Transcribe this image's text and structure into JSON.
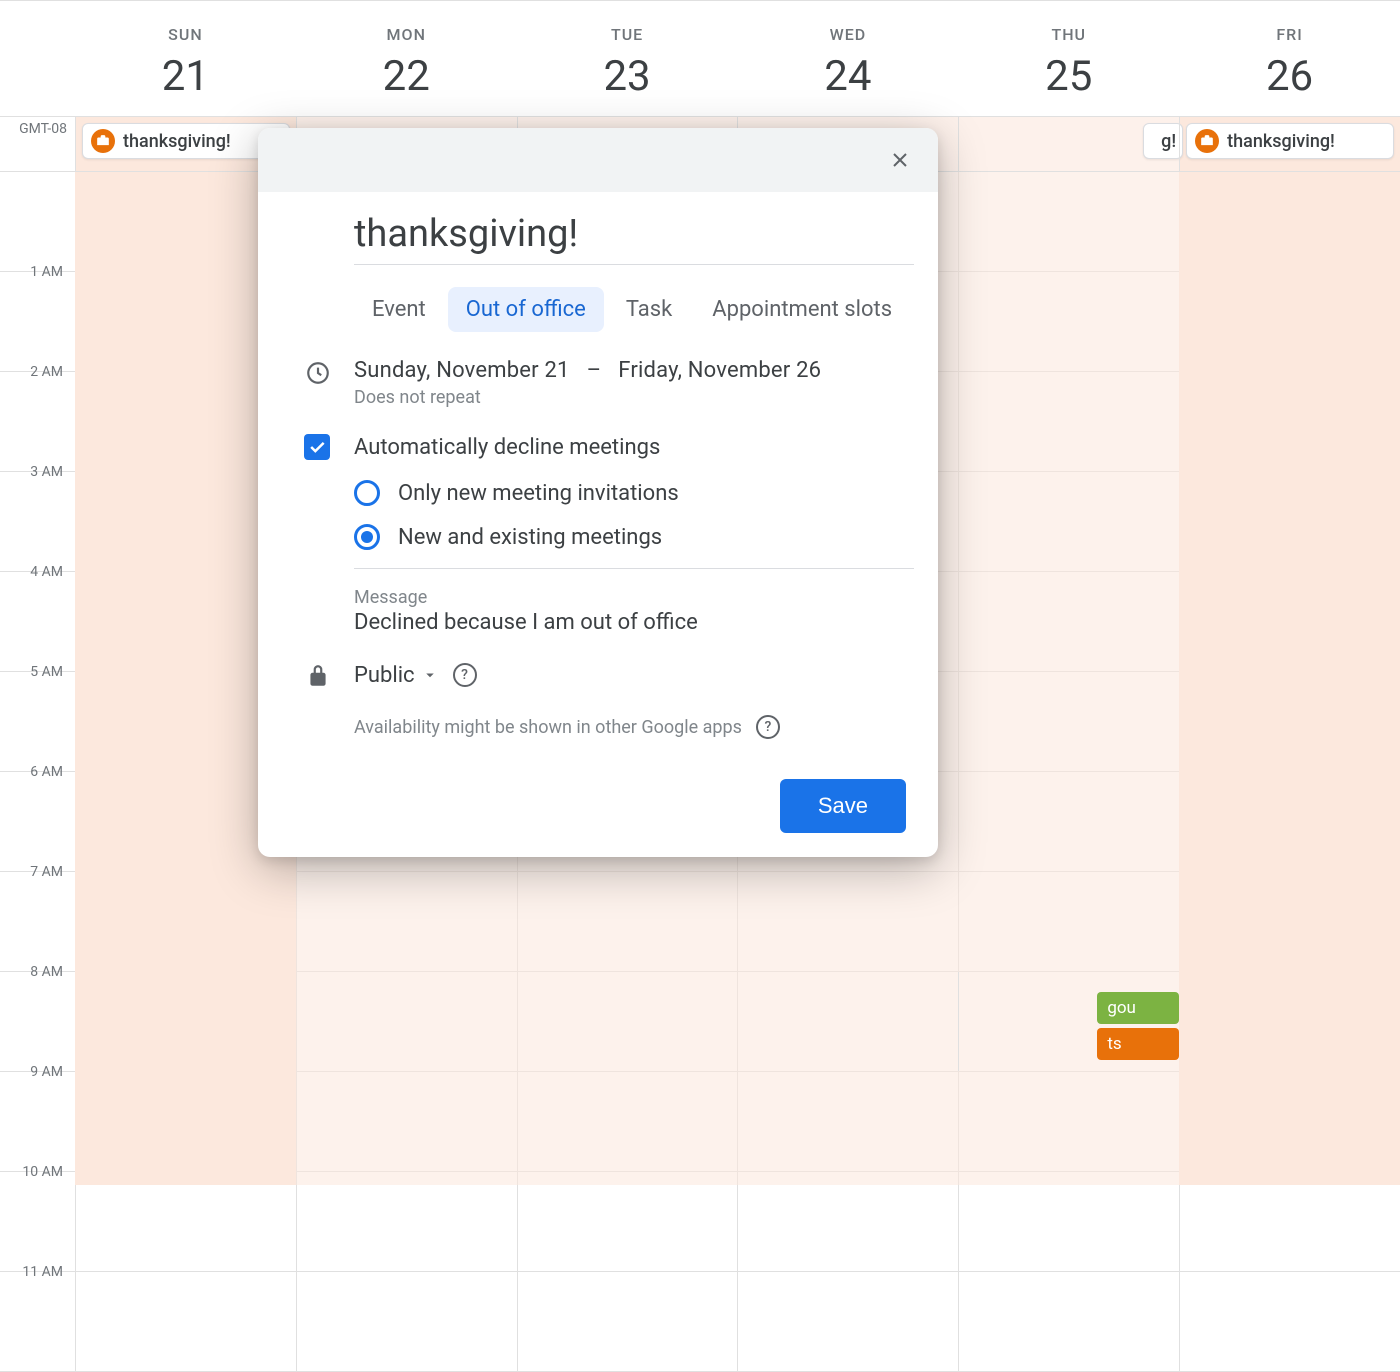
{
  "calendar": {
    "timezone": "GMT-08",
    "days": [
      {
        "name": "SUN",
        "num": "21"
      },
      {
        "name": "MON",
        "num": "22"
      },
      {
        "name": "TUE",
        "num": "23"
      },
      {
        "name": "WED",
        "num": "24"
      },
      {
        "name": "THU",
        "num": "25"
      },
      {
        "name": "FRI",
        "num": "26"
      }
    ],
    "hours": [
      "1 AM",
      "2 AM",
      "3 AM",
      "4 AM",
      "5 AM",
      "6 AM",
      "7 AM",
      "8 AM",
      "9 AM",
      "10 AM",
      "11 AM"
    ],
    "allday_event_title": "thanksgiving!",
    "thu_badges": [
      {
        "label": "gou",
        "color": "#7cb342"
      },
      {
        "label": "ts",
        "color": "#e8710a"
      }
    ]
  },
  "modal": {
    "title_value": "thanksgiving!",
    "tabs": [
      "Event",
      "Out of office",
      "Task",
      "Appointment slots"
    ],
    "active_tab_index": 1,
    "date_start": "Sunday, November 21",
    "date_sep": "–",
    "date_end": "Friday, November 26",
    "repeat": "Does not repeat",
    "auto_decline_label": "Automatically decline meetings",
    "auto_decline_checked": true,
    "radio_options": [
      "Only new meeting invitations",
      "New and existing meetings"
    ],
    "radio_selected_index": 1,
    "message_label": "Message",
    "message_value": "Declined because I am out of office",
    "visibility": "Public",
    "hint": "Availability might be shown in other Google apps",
    "save_label": "Save"
  }
}
